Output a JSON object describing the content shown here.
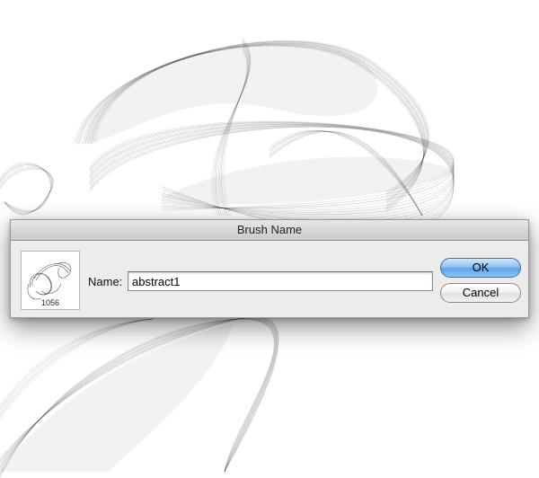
{
  "dialog": {
    "title": "Brush Name",
    "name_label": "Name:",
    "name_value": "abstract1",
    "ok_label": "OK",
    "cancel_label": "Cancel"
  },
  "brush_preview": {
    "count": "1056",
    "icon": "brush-preview-icon"
  },
  "colors": {
    "ok_accent": "#6aa8e8",
    "dialog_bg": "#ececec",
    "smoke": "#000000"
  }
}
